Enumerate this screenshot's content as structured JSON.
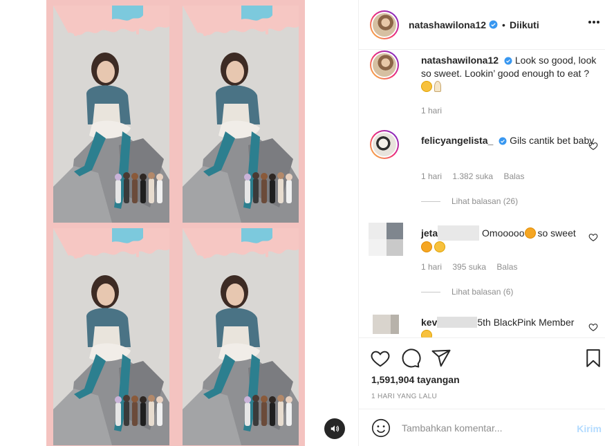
{
  "post": {
    "author": "natashawilona12",
    "follow_status": "Diikuti",
    "header_separator": "•"
  },
  "caption": {
    "username": "natashawilona12",
    "text": "Look so good, look so sweet. Lookin’ good enough to eat ?",
    "time": "1 hari"
  },
  "comments": [
    {
      "username": "felicyangelista_",
      "text": "Gils cantik bet baby",
      "time": "1 hari",
      "likes": "1.382 suka",
      "reply_label": "Balas",
      "view_replies": "Lihat balasan (26)"
    },
    {
      "username_visible": "jeta",
      "text_after": "Omooooo",
      "text_tail": "so sweet",
      "time": "1 hari",
      "likes": "395 suka",
      "reply_label": "Balas",
      "view_replies": "Lihat balasan (6)"
    },
    {
      "username_visible": "kev",
      "text": "5th BlackPink Member"
    }
  ],
  "stats": {
    "views": "1,591,904 tayangan",
    "date": "1 HARI YANG LALU"
  },
  "composer": {
    "placeholder": "Tambahkan komentar...",
    "post_label": "Kirim"
  },
  "colors": {
    "link_disabled": "#b3dbff",
    "secondary_text": "#8e8e8e",
    "verified": "#3897f0",
    "media_background": "#f4c3c0"
  },
  "icons": [
    "verified-badge-icon",
    "more-options-icon",
    "heart-icon",
    "comment-icon",
    "share-icon",
    "bookmark-icon",
    "emoji-icon",
    "sound-icon"
  ]
}
